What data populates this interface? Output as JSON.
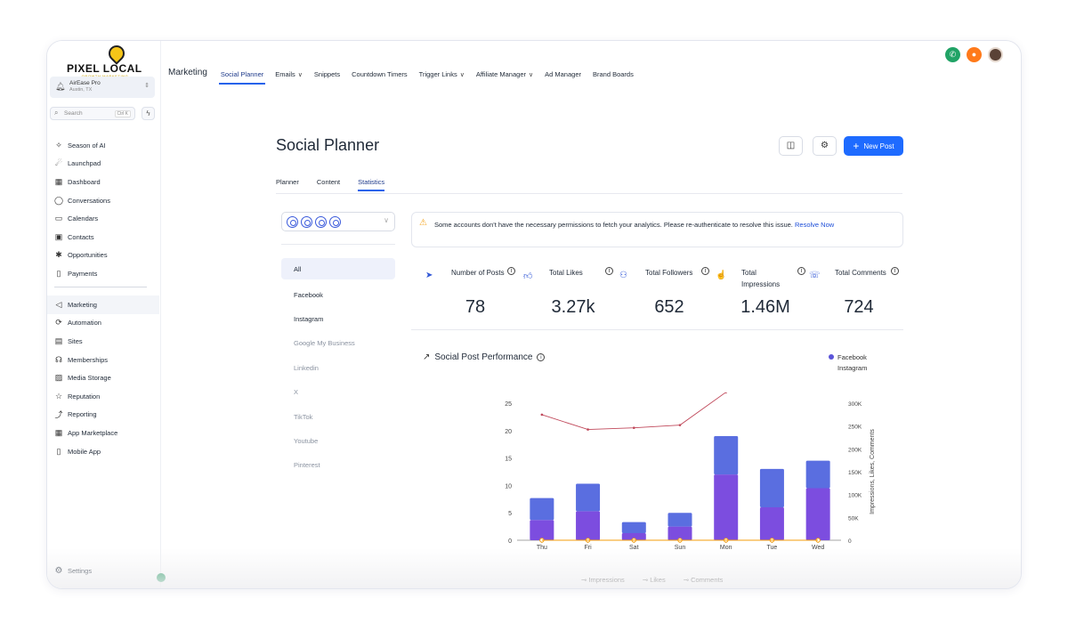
{
  "brand": {
    "logo_text": "PIXEL LOCAL",
    "logo_sub": "GROWTH MARKETING"
  },
  "account": {
    "name": "AirEase Pro",
    "location": "Austin, TX"
  },
  "search": {
    "placeholder": "Search",
    "shortcut": "Ctrl K"
  },
  "sidebar": {
    "items": [
      {
        "label": "Season of AI",
        "icon": "sparkle-icon"
      },
      {
        "label": "Launchpad",
        "icon": "rocket-icon"
      },
      {
        "label": "Dashboard",
        "icon": "dashboard-icon"
      },
      {
        "label": "Conversations",
        "icon": "chat-icon"
      },
      {
        "label": "Calendars",
        "icon": "calendar-icon"
      },
      {
        "label": "Contacts",
        "icon": "contacts-icon"
      },
      {
        "label": "Opportunities",
        "icon": "opportunities-icon"
      },
      {
        "label": "Payments",
        "icon": "payments-icon"
      }
    ],
    "items2": [
      {
        "label": "Marketing",
        "icon": "send-icon"
      },
      {
        "label": "Automation",
        "icon": "automation-icon"
      },
      {
        "label": "Sites",
        "icon": "sites-icon"
      },
      {
        "label": "Memberships",
        "icon": "memberships-icon"
      },
      {
        "label": "Media Storage",
        "icon": "media-icon"
      },
      {
        "label": "Reputation",
        "icon": "star-icon"
      },
      {
        "label": "Reporting",
        "icon": "reporting-icon"
      },
      {
        "label": "App Marketplace",
        "icon": "apps-icon"
      },
      {
        "label": "Mobile App",
        "icon": "mobile-icon"
      }
    ],
    "settings_label": "Settings"
  },
  "topnav": {
    "section": "Marketing",
    "items": [
      "Social Planner",
      "Emails",
      "Snippets",
      "Countdown Timers",
      "Trigger Links",
      "Affiliate Manager",
      "Ad Manager",
      "Brand Boards"
    ]
  },
  "page": {
    "title": "Social Planner",
    "new_post_label": "New Post"
  },
  "subtabs": [
    "Planner",
    "Content",
    "Statistics"
  ],
  "platforms": [
    "All",
    "Facebook",
    "Instagram",
    "Google My Business",
    "Linkedin",
    "X",
    "TikTok",
    "Youtube",
    "Pinterest"
  ],
  "alert": {
    "text": "Some accounts don't have the necessary permissions to fetch your analytics. Please re-authenticate to resolve this issue.",
    "link": "Resolve Now"
  },
  "metrics": [
    {
      "label": "Number of Posts",
      "value": "78"
    },
    {
      "label": "Total Likes",
      "value": "3.27k"
    },
    {
      "label": "Total Followers",
      "value": "652"
    },
    {
      "label": "Total Impressions",
      "value": "1.46M"
    },
    {
      "label": "Total Comments",
      "value": "724"
    }
  ],
  "chart_title": "Social Post Performance",
  "colors": {
    "accent": "#1e6bff",
    "bar_top": "#5a6ee0",
    "bar_bottom": "#7c4ddf",
    "line": "#c0495b",
    "comments": "#f59e0b"
  },
  "chart_data": {
    "type": "bar",
    "categories": [
      "Thu",
      "Fri",
      "Sat",
      "Sun",
      "Mon",
      "Tue",
      "Wed"
    ],
    "series": [
      {
        "name": "Facebook",
        "values": [
          4,
          5,
          2,
          2.5,
          7,
          7,
          5
        ]
      },
      {
        "name": "Instagram",
        "values": [
          3.7,
          5.3,
          1.3,
          2.5,
          12,
          6,
          9.5
        ]
      }
    ],
    "line_series": [
      {
        "name": "Impressions",
        "values": [
          0,
          0,
          0,
          0,
          0,
          0,
          0
        ]
      },
      {
        "name": "Likes",
        "values": [
          22.9,
          20.2,
          20.5,
          21,
          27
        ]
      },
      {
        "name": "Comments",
        "values": [
          0,
          0,
          0,
          0,
          0,
          0,
          0
        ]
      }
    ],
    "ylim": [
      0,
      25
    ],
    "yticks": [
      "0",
      "5",
      "10",
      "15",
      "20",
      "25"
    ],
    "y2ticks": [
      "0",
      "50K",
      "100K",
      "150K",
      "200K",
      "250K",
      "300K"
    ],
    "y2label": "Impressions, Likes, Comments",
    "legend": [
      "Facebook",
      "Instagram"
    ],
    "bottom_legend": [
      "Impressions",
      "Likes",
      "Comments"
    ]
  }
}
